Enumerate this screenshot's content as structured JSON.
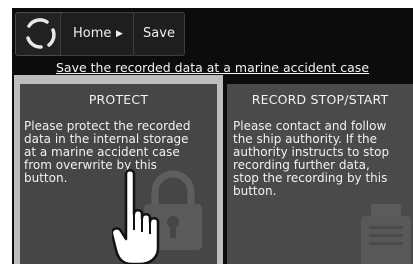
{
  "header": {
    "home_label": "Home",
    "save_label": "Save"
  },
  "subtitle": "Save the recorded data at a marine accident case",
  "panels": {
    "protect": {
      "title": "PROTECT",
      "lines": [
        "Please protect the recorded",
        "data in the internal storage",
        "at a marine accident case",
        "from overwrite by this",
        "button."
      ]
    },
    "record": {
      "title": "RECORD STOP/START",
      "lines": [
        "Please contact and follow",
        "the ship authority. If the",
        "authority instructs to stop",
        "recording further data,",
        "stop the recording by this",
        "button."
      ]
    }
  },
  "colors": {
    "background": "#0c0c0c",
    "panel": "#4a4a4a",
    "selected_frame": "#bdbdbd",
    "text": "#f2f2f2"
  },
  "icons": [
    "logo-icon",
    "chevron-right-icon",
    "padlock-icon",
    "recorder-icon",
    "pointing-hand-icon"
  ]
}
